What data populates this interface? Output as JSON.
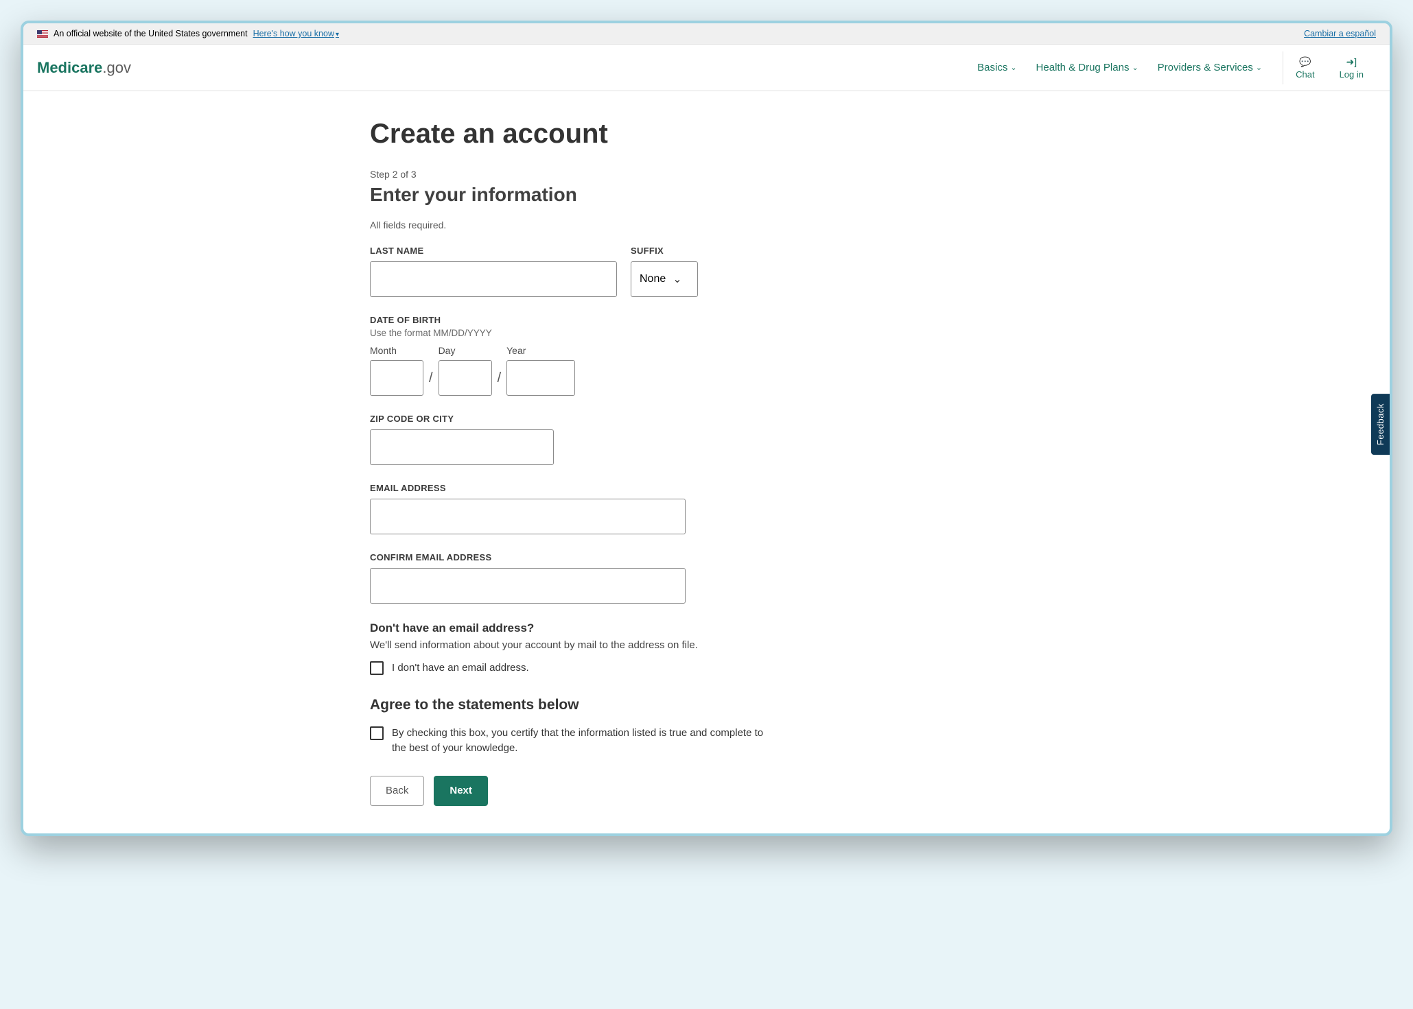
{
  "banner": {
    "official_text": "An official website of the United States government",
    "how_you_know": "Here's how you know",
    "lang_switch": "Cambiar a español"
  },
  "logo": {
    "brand": "Medicare",
    "tld": ".gov"
  },
  "nav": {
    "basics": "Basics",
    "health": "Health & Drug Plans",
    "providers": "Providers & Services"
  },
  "header_actions": {
    "chat": "Chat",
    "login": "Log in"
  },
  "page": {
    "title": "Create an account",
    "step": "Step 2 of 3",
    "subtitle": "Enter your information",
    "required": "All fields required."
  },
  "form": {
    "last_name_label": "LAST NAME",
    "suffix_label": "SUFFIX",
    "suffix_value": "None",
    "dob_label": "DATE OF BIRTH",
    "dob_hint": "Use the format MM/DD/YYYY",
    "month_label": "Month",
    "day_label": "Day",
    "year_label": "Year",
    "zip_label": "ZIP CODE OR CITY",
    "email_label": "EMAIL ADDRESS",
    "confirm_email_label": "CONFIRM EMAIL ADDRESS",
    "no_email_heading": "Don't have an email address?",
    "no_email_text": "We'll send information about your account by mail to the address on file.",
    "no_email_check": "I don't have an email address.",
    "agree_heading": "Agree to the statements below",
    "agree_text": "By checking this box, you certify that the information listed is true and complete to the best of your knowledge.",
    "back": "Back",
    "next": "Next"
  },
  "feedback": "Feedback"
}
